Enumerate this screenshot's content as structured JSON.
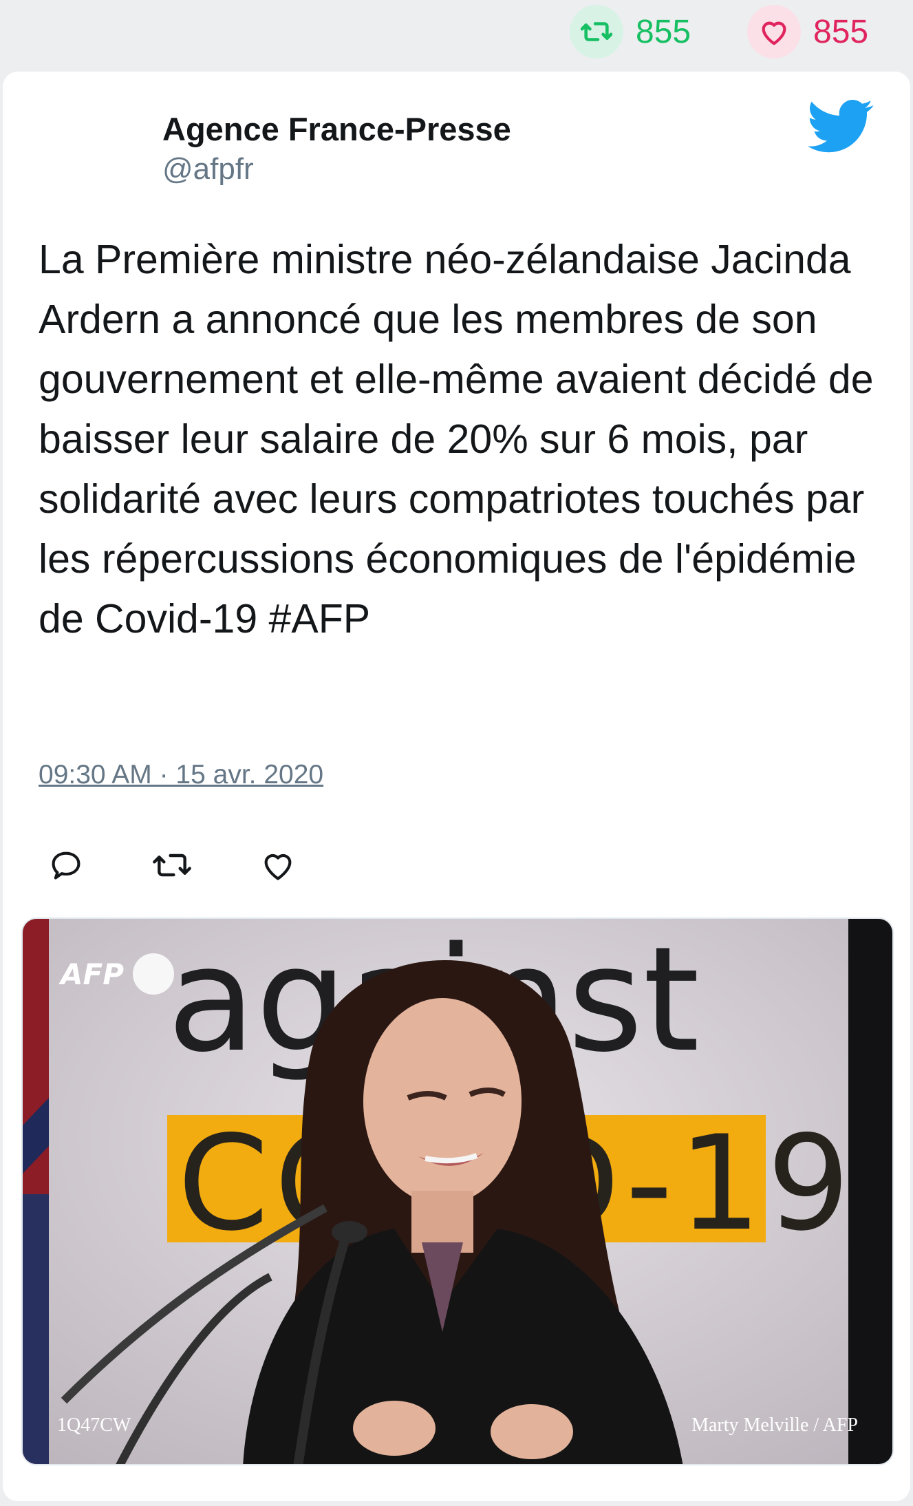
{
  "engagement": {
    "retweet_count": "855",
    "like_count": "855",
    "retweet_color": "#17bf63",
    "like_color": "#e0245e"
  },
  "tweet": {
    "author_name": "Agence France-Presse",
    "author_handle": "@afpfr",
    "text": "La Première ministre néo-zélandaise Jacinda Ardern a annoncé que les membres de son gouvernement et elle-même avaient décidé de baisser leur salaire de 20% sur 6 mois, par solidarité avec leurs compatriotes touchés par les répercussions économiques de l'épidémie de Covid-19 #AFP",
    "timestamp": "09:30 AM · 15 avr. 2020",
    "actions": [
      {
        "icon": "reply-icon"
      },
      {
        "icon": "retweet-icon"
      },
      {
        "icon": "like-icon"
      }
    ]
  },
  "media": {
    "agency_logo": "AFP",
    "backdrop_word": "against",
    "backdrop_banner": "COVID-19",
    "photo_code": "1Q47CW",
    "photo_credit": "Marty Melville / AFP"
  },
  "icons": {
    "brand": "twitter-bird-icon",
    "brand_color": "#1da1f2"
  }
}
